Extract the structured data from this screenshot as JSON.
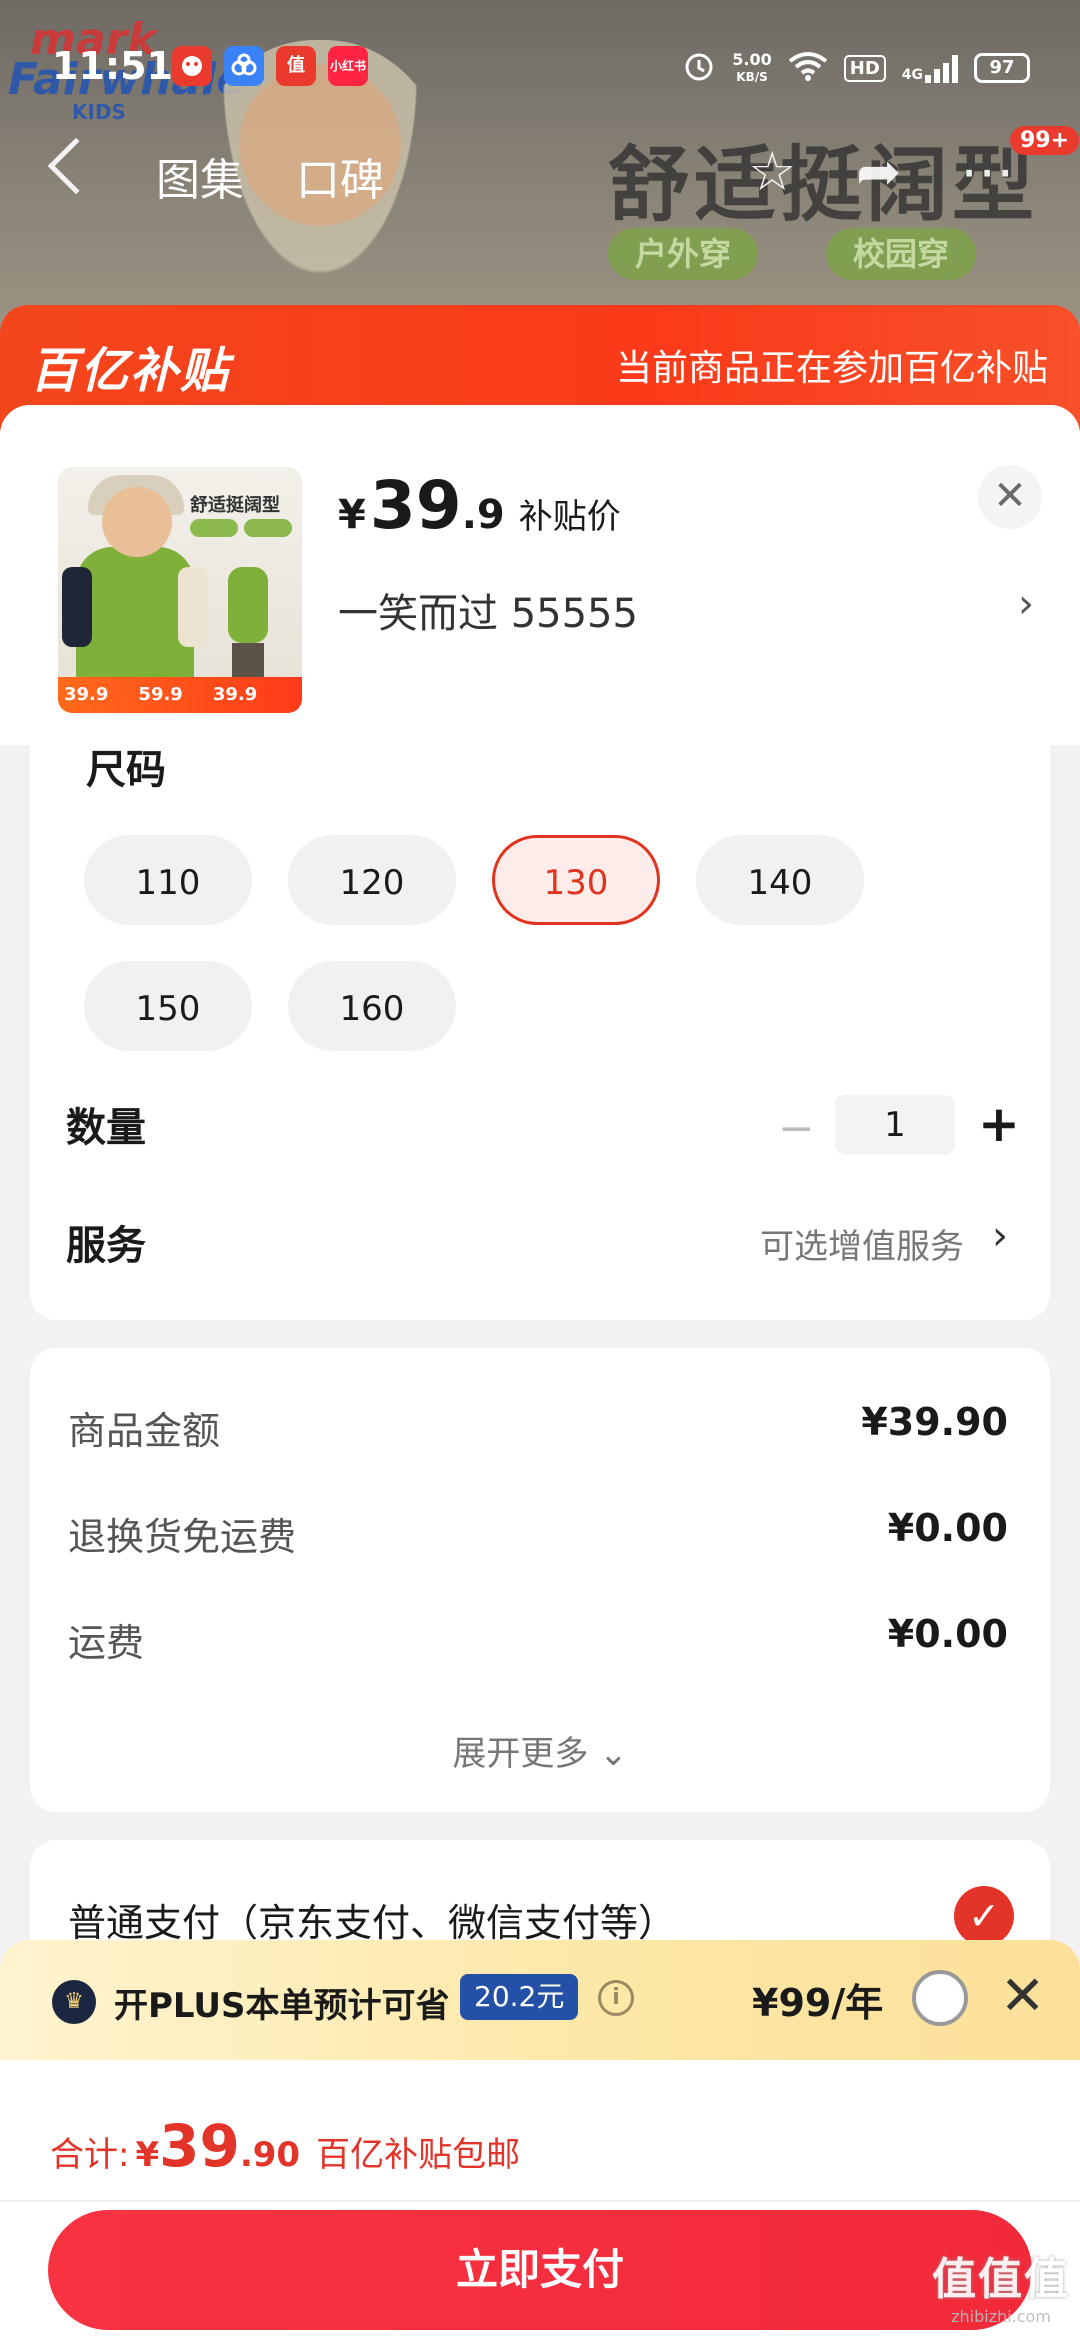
{
  "status_bar": {
    "time": "11:51",
    "app_icons": [
      "jd-app-icon",
      "baidu-netdisk-icon",
      "zhide-icon",
      "xiaohongshu-icon"
    ],
    "app_icon_labels": [
      "",
      "",
      "值",
      "小红书"
    ],
    "net_speed": "5.00",
    "net_unit": "KB/S",
    "hd": "HD",
    "signal": "4G",
    "battery": "97"
  },
  "product_header": {
    "brand_line1": "mark",
    "brand_line2": "Fairwhale",
    "brand_line3": "KIDS",
    "tabs": [
      "图集",
      "口碑"
    ],
    "slogan": "舒适挺阔型",
    "pills": [
      "户外穿",
      "校园穿"
    ],
    "cart_badge": "99+"
  },
  "subsidy": {
    "logo": "百亿补贴",
    "text": "当前商品正在参加百亿补贴"
  },
  "product": {
    "price_symbol": "¥",
    "price_int": "39",
    "price_dec": ".9",
    "price_tag": "补贴价",
    "selected_spec": "一笑而过  55555",
    "thumb": {
      "slogan": "舒适挺阔型",
      "prices": [
        "39.9",
        "59.9",
        "39.9"
      ]
    }
  },
  "size": {
    "label": "尺码",
    "options": [
      "110",
      "120",
      "130",
      "140",
      "150",
      "160"
    ],
    "selected": "130"
  },
  "quantity": {
    "label": "数量",
    "value": "1",
    "minus": "−",
    "plus": "+"
  },
  "service": {
    "label": "服务",
    "hint": "可选增值服务"
  },
  "costs": {
    "rows": [
      {
        "label": "商品金额",
        "value": "¥39.90"
      },
      {
        "label": "退换货免运费",
        "value": "¥0.00"
      },
      {
        "label": "运费",
        "value": "¥0.00"
      }
    ],
    "expand": "展开更多"
  },
  "payment": {
    "label": "普通支付（京东支付、微信支付等）"
  },
  "plus": {
    "text": "开PLUS本单预计可省",
    "save": "20.2元",
    "price": "¥99/年"
  },
  "bottom": {
    "total_label": "合计:",
    "total_symbol": "¥",
    "total_int": "39",
    "total_dec": ".90",
    "total_note": "百亿补贴包邮",
    "pay_button": "立即支付"
  },
  "watermark": {
    "text": "值值值",
    "url": "zhibizhi.com"
  },
  "colors": {
    "accent_red": "#e3342a",
    "subsidy_orange": "#f4461d",
    "plus_blue": "#2450a8"
  }
}
